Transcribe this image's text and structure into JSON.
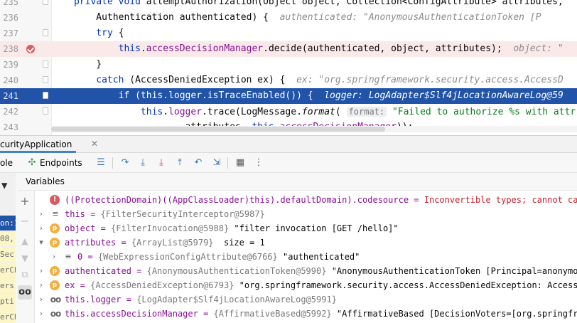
{
  "editor": {
    "lines": [
      {
        "num": "235",
        "parts": [
          [
            "kw",
            "private void "
          ],
          [
            "",
            "attemptAuthorization(Object object, Collection<ConfigAttribute> attributes,"
          ]
        ]
      },
      {
        "num": "236",
        "parts": [
          [
            "",
            "    Authentication authenticated) {  "
          ],
          [
            "hint",
            "authenticated: \"AnonymousAuthenticationToken [P"
          ]
        ]
      },
      {
        "num": "237",
        "parts": [
          [
            "kw",
            "    try "
          ],
          [
            "",
            "{"
          ]
        ]
      },
      {
        "num": "238",
        "parts": [
          [
            "kw",
            "        this"
          ],
          [
            "",
            "."
          ],
          [
            "fld",
            "accessDecisionManager"
          ],
          [
            "",
            ".decide(authenticated, object, attributes);  "
          ],
          [
            "hint",
            "object: \""
          ]
        ]
      },
      {
        "num": "239",
        "parts": [
          [
            "",
            "    }"
          ]
        ]
      },
      {
        "num": "240",
        "parts": [
          [
            "kw",
            "    catch "
          ],
          [
            "",
            "(AccessDeniedException ex) {  "
          ],
          [
            "hint",
            "ex: \"org.springframework.security.access.AccessD"
          ]
        ]
      },
      {
        "num": "241",
        "parts": [
          [
            "kw",
            "        if "
          ],
          [
            "",
            "("
          ],
          [
            "kw",
            "this"
          ],
          [
            "",
            "."
          ],
          [
            "fld",
            "logger"
          ],
          [
            "",
            ".isTraceEnabled()) {  "
          ],
          [
            "hint",
            "logger: LogAdapter$Slf4jLocationAwareLog@59"
          ]
        ]
      },
      {
        "num": "242",
        "parts": [
          [
            "kw",
            "            this"
          ],
          [
            "",
            "."
          ],
          [
            "fld",
            "logger"
          ],
          [
            "",
            ".trace(LogMessage."
          ],
          [
            "ital",
            "format"
          ],
          [
            "",
            "( "
          ],
          [
            "param",
            "format:"
          ],
          [
            "",
            " "
          ],
          [
            "str",
            "\"Failed to authorize %s with attr"
          ]
        ]
      },
      {
        "num": "243",
        "parts": [
          [
            "",
            "                    attributes, "
          ],
          [
            "kw",
            "this"
          ],
          [
            "",
            "."
          ],
          [
            "fld",
            "accessDecisionManager"
          ],
          [
            "",
            "));"
          ]
        ]
      }
    ]
  },
  "debug_tab": {
    "title": "curityApplication",
    "close_icon": "close-icon"
  },
  "toolbar": {
    "console_label": "ole",
    "endpoints_label": "Endpoints"
  },
  "variables": {
    "header": "Variables",
    "rows": [
      {
        "arrow": "",
        "icon": "error",
        "parts": [
          [
            "",
            "((ProtectionDomain)((AppClassLoader)this).defaultDomain).codesource = "
          ],
          [
            "verr",
            "Inconvertible types; cannot cast"
          ]
        ]
      },
      {
        "arrow": ">",
        "icon": "eq",
        "parts": [
          [
            "",
            "this = "
          ],
          [
            "vtype",
            "{FilterSecurityInterceptor@5987}"
          ]
        ]
      },
      {
        "arrow": ">",
        "icon": "p",
        "parts": [
          [
            "",
            "object = "
          ],
          [
            "vtype",
            "{FilterInvocation@5988}"
          ],
          [
            "",
            " \"filter invocation [GET /hello]\""
          ]
        ]
      },
      {
        "arrow": "v",
        "icon": "p",
        "parts": [
          [
            "",
            "attributes = "
          ],
          [
            "vtype",
            "{ArrayList@5979}"
          ],
          [
            "",
            "  size = 1"
          ]
        ]
      },
      {
        "arrow": ">",
        "icon": "eq",
        "indent": true,
        "parts": [
          [
            "",
            "0 = "
          ],
          [
            "vtype",
            "{WebExpressionConfigAttribute@6766}"
          ],
          [
            "",
            " \"authenticated\""
          ]
        ]
      },
      {
        "arrow": ">",
        "icon": "p",
        "parts": [
          [
            "",
            "authenticated = "
          ],
          [
            "vtype",
            "{AnonymousAuthenticationToken@5990}"
          ],
          [
            "",
            " \"AnonymousAuthenticationToken [Principal=anonymousU"
          ]
        ]
      },
      {
        "arrow": ">",
        "icon": "p",
        "parts": [
          [
            "",
            "ex = "
          ],
          [
            "vtype",
            "{AccessDeniedException@6793}"
          ],
          [
            "",
            " \"org.springframework.security.access.AccessDeniedException: Access is"
          ]
        ]
      },
      {
        "arrow": ">",
        "icon": "oo",
        "parts": [
          [
            "",
            "this.logger = "
          ],
          [
            "vtype",
            "{LogAdapter$Slf4jLocationAwareLog@5991}"
          ]
        ]
      },
      {
        "arrow": ">",
        "icon": "oo",
        "parts": [
          [
            "",
            "this.accessDecisionManager = "
          ],
          [
            "vtype",
            "{AffirmativeBased@5992}"
          ],
          [
            "",
            " \"AffirmativeBased [DecisionVoters=[org.springframe"
          ]
        ]
      }
    ]
  },
  "sidebar": {
    "rows": [
      "on:1",
      "08,",
      "Sec",
      "erCh",
      "ers",
      "pti",
      "erCh",
      "pti"
    ]
  },
  "colors": {
    "accent": "#2154a8",
    "breakpoint": "#db5c5c",
    "keyword": "#0033b3",
    "field": "#871094",
    "string": "#067d17"
  }
}
